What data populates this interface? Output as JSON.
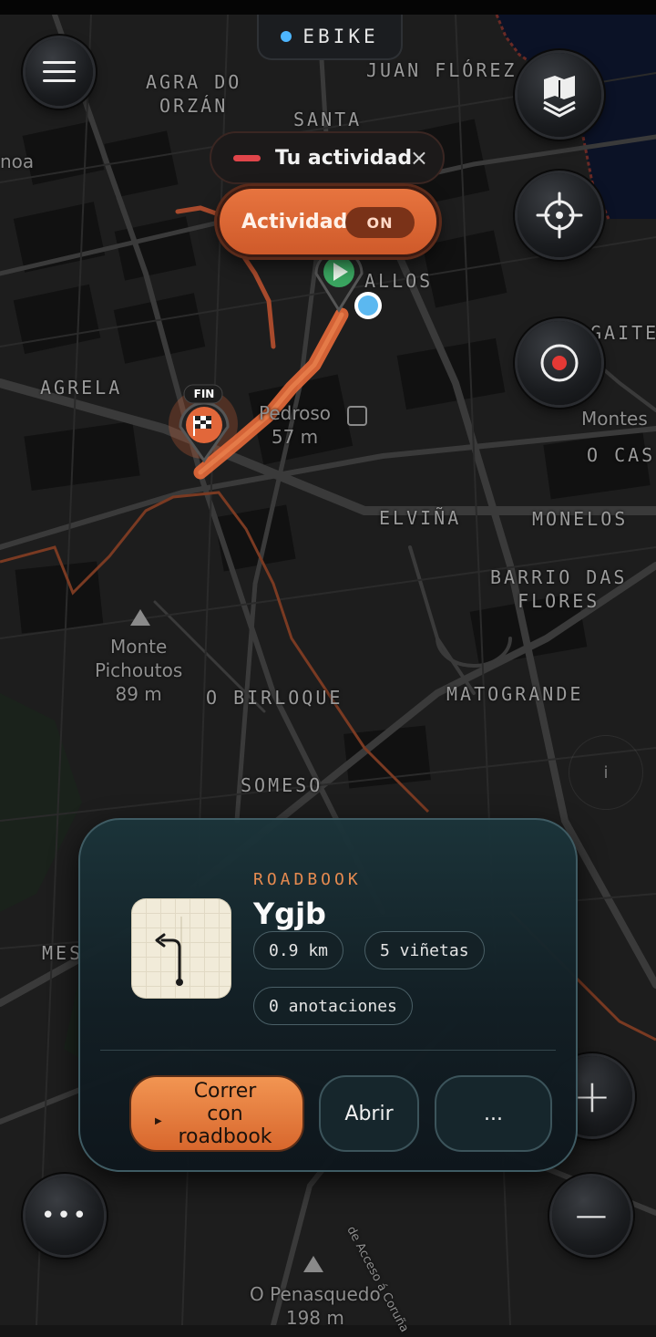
{
  "activity_mode": {
    "label": "EBIKE",
    "dot_color": "#4db6ff"
  },
  "map": {
    "labels": [
      "AGRA DO\nORZÁN",
      "JUAN FLÓREZ",
      "SANTA",
      "noa",
      "ALLOS",
      "GAITE",
      "AGRELA",
      "Pedroso\n57 m",
      "Montes",
      "O CAS",
      "ELVIÑA",
      "MONELOS",
      "BARRIO DAS\nFLORES",
      "Monte\nPichoutos\n89 m",
      "O BIRLOQUE",
      "MATOGRANDE",
      "SOMESO",
      "MES",
      "O Penasquedo\n198 m",
      "de Acceso á Coruña"
    ],
    "finish_marker": "FIN",
    "route_color": "#e86a3a",
    "info_label": "i"
  },
  "activity_panel": {
    "title": "Tu actividad",
    "close": "×",
    "toggle_label": "Actividad",
    "toggle_state": "ON"
  },
  "controls": {
    "menu": "menu-icon",
    "layers": "layers-icon",
    "locate": "crosshair-icon",
    "record": "record-icon",
    "more": "•••",
    "zoom_in": "+",
    "zoom_out": "−"
  },
  "roadbook": {
    "kicker": "ROADBOOK",
    "title": "Ygjb",
    "distance": "0.9 km",
    "vignettes": "5 viñetas",
    "annotations": "0 anotaciones",
    "primary_action": "Correr con roadbook",
    "open_action": "Abrir",
    "more_action": "..."
  }
}
